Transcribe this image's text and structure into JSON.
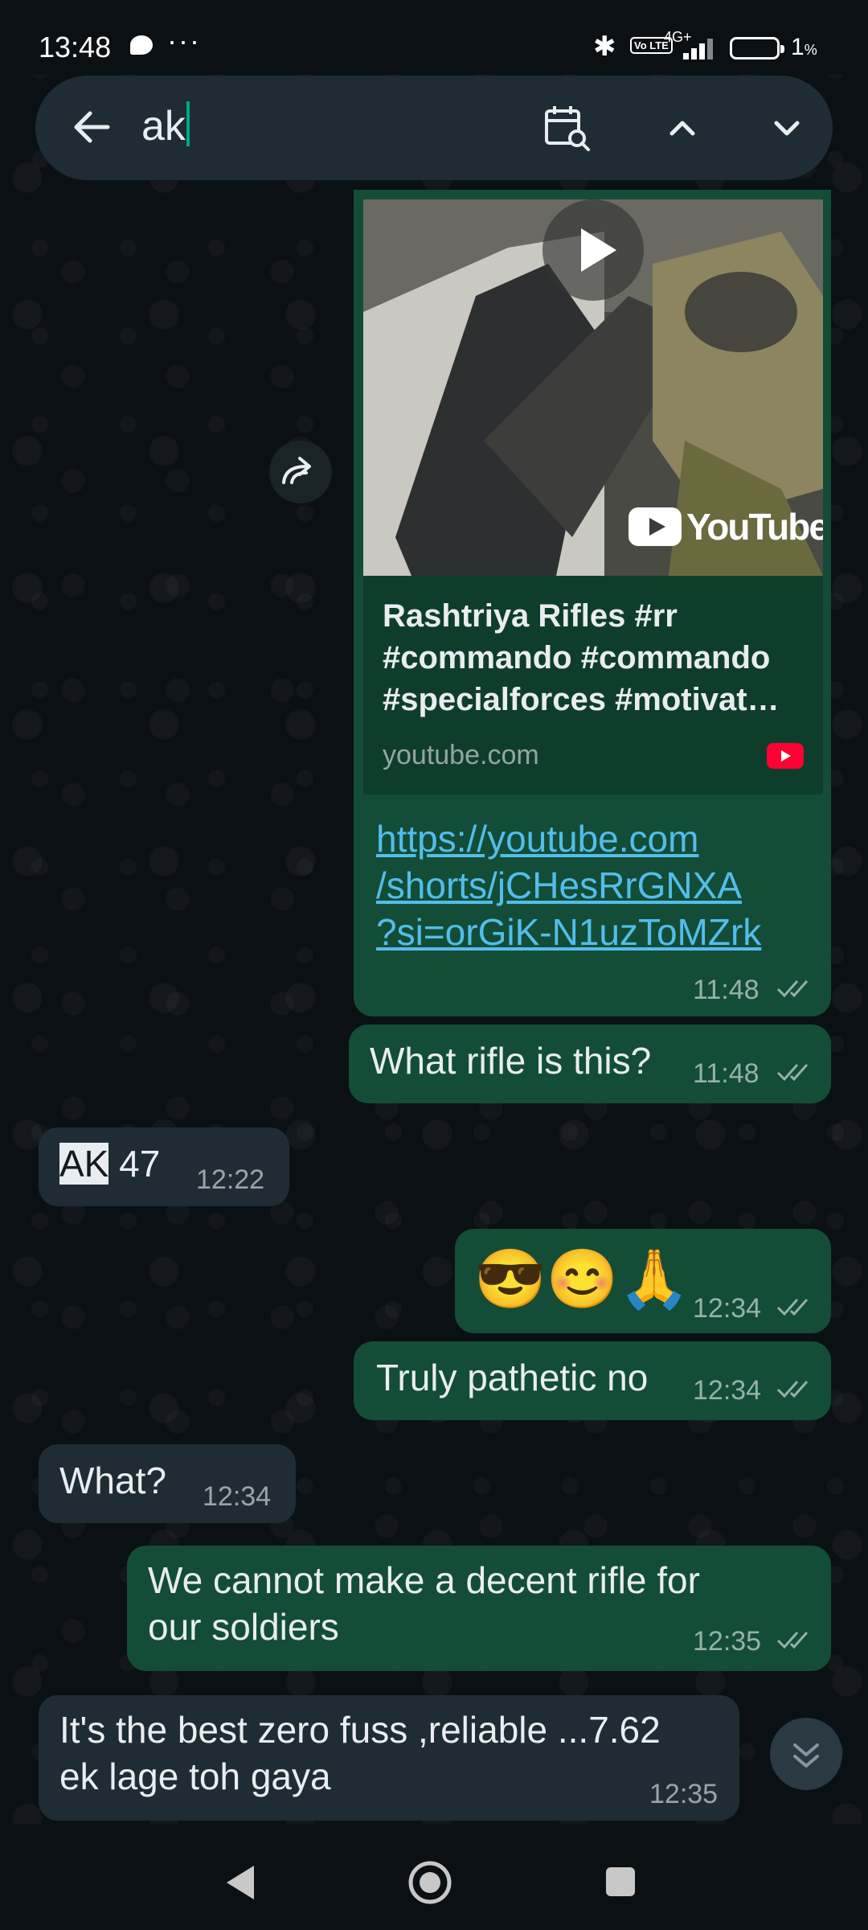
{
  "status_bar": {
    "time": "13:48",
    "dots": "···",
    "network": "4G+",
    "volte": "Vo LTE",
    "battery": "1",
    "battery_unit": "%"
  },
  "search": {
    "query": "ak"
  },
  "messages": {
    "link_preview": {
      "title_line1": "Rashtriya Rifles #rr",
      "title_line2": "#commando #commando",
      "title_line3": "#specialforces #motivat…",
      "domain": "youtube.com",
      "youtube_label": "YouTube",
      "url_line1": "https://youtube.com",
      "url_line2": "/shorts/jCHesRrGNXA",
      "url_line3": "?si=orGiK-N1uzToMZrk",
      "time": "11:48"
    },
    "m1": {
      "text": "What rifle is this?",
      "time": "11:48"
    },
    "m2": {
      "highlight": "AK",
      "text": " 47",
      "time": "12:22"
    },
    "m3": {
      "text": "😎😊🙏",
      "time": "12:34"
    },
    "m4": {
      "text": "Truly pathetic no",
      "time": "12:34"
    },
    "m5": {
      "text": "What?",
      "time": "12:34"
    },
    "m6": {
      "line1": "We cannot make a decent rifle for",
      "line2": "our soldiers",
      "time": "12:35"
    },
    "m7": {
      "line1": "It's the best zero fuss ,reliable ...7.62",
      "line2": "ek lage toh gaya",
      "time": "12:35"
    }
  },
  "colors": {
    "outgoing_bubble": "#134d37",
    "incoming_bubble": "#202c33",
    "link": "#53bdeb",
    "accent": "#00a884"
  }
}
